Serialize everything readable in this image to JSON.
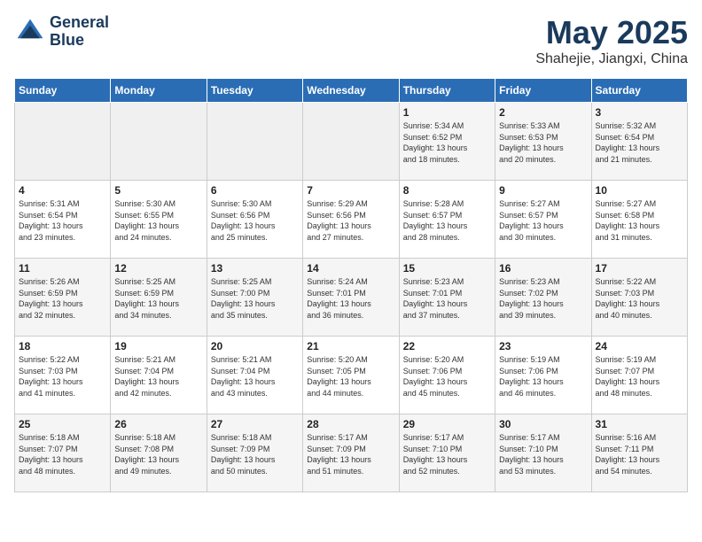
{
  "header": {
    "logo_line1": "General",
    "logo_line2": "Blue",
    "month": "May 2025",
    "location": "Shahejie, Jiangxi, China"
  },
  "weekdays": [
    "Sunday",
    "Monday",
    "Tuesday",
    "Wednesday",
    "Thursday",
    "Friday",
    "Saturday"
  ],
  "weeks": [
    [
      {
        "day": "",
        "info": "",
        "empty": true
      },
      {
        "day": "",
        "info": "",
        "empty": true
      },
      {
        "day": "",
        "info": "",
        "empty": true
      },
      {
        "day": "",
        "info": "",
        "empty": true
      },
      {
        "day": "1",
        "info": "Sunrise: 5:34 AM\nSunset: 6:52 PM\nDaylight: 13 hours\nand 18 minutes.",
        "empty": false
      },
      {
        "day": "2",
        "info": "Sunrise: 5:33 AM\nSunset: 6:53 PM\nDaylight: 13 hours\nand 20 minutes.",
        "empty": false
      },
      {
        "day": "3",
        "info": "Sunrise: 5:32 AM\nSunset: 6:54 PM\nDaylight: 13 hours\nand 21 minutes.",
        "empty": false
      }
    ],
    [
      {
        "day": "4",
        "info": "Sunrise: 5:31 AM\nSunset: 6:54 PM\nDaylight: 13 hours\nand 23 minutes.",
        "empty": false
      },
      {
        "day": "5",
        "info": "Sunrise: 5:30 AM\nSunset: 6:55 PM\nDaylight: 13 hours\nand 24 minutes.",
        "empty": false
      },
      {
        "day": "6",
        "info": "Sunrise: 5:30 AM\nSunset: 6:56 PM\nDaylight: 13 hours\nand 25 minutes.",
        "empty": false
      },
      {
        "day": "7",
        "info": "Sunrise: 5:29 AM\nSunset: 6:56 PM\nDaylight: 13 hours\nand 27 minutes.",
        "empty": false
      },
      {
        "day": "8",
        "info": "Sunrise: 5:28 AM\nSunset: 6:57 PM\nDaylight: 13 hours\nand 28 minutes.",
        "empty": false
      },
      {
        "day": "9",
        "info": "Sunrise: 5:27 AM\nSunset: 6:57 PM\nDaylight: 13 hours\nand 30 minutes.",
        "empty": false
      },
      {
        "day": "10",
        "info": "Sunrise: 5:27 AM\nSunset: 6:58 PM\nDaylight: 13 hours\nand 31 minutes.",
        "empty": false
      }
    ],
    [
      {
        "day": "11",
        "info": "Sunrise: 5:26 AM\nSunset: 6:59 PM\nDaylight: 13 hours\nand 32 minutes.",
        "empty": false
      },
      {
        "day": "12",
        "info": "Sunrise: 5:25 AM\nSunset: 6:59 PM\nDaylight: 13 hours\nand 34 minutes.",
        "empty": false
      },
      {
        "day": "13",
        "info": "Sunrise: 5:25 AM\nSunset: 7:00 PM\nDaylight: 13 hours\nand 35 minutes.",
        "empty": false
      },
      {
        "day": "14",
        "info": "Sunrise: 5:24 AM\nSunset: 7:01 PM\nDaylight: 13 hours\nand 36 minutes.",
        "empty": false
      },
      {
        "day": "15",
        "info": "Sunrise: 5:23 AM\nSunset: 7:01 PM\nDaylight: 13 hours\nand 37 minutes.",
        "empty": false
      },
      {
        "day": "16",
        "info": "Sunrise: 5:23 AM\nSunset: 7:02 PM\nDaylight: 13 hours\nand 39 minutes.",
        "empty": false
      },
      {
        "day": "17",
        "info": "Sunrise: 5:22 AM\nSunset: 7:03 PM\nDaylight: 13 hours\nand 40 minutes.",
        "empty": false
      }
    ],
    [
      {
        "day": "18",
        "info": "Sunrise: 5:22 AM\nSunset: 7:03 PM\nDaylight: 13 hours\nand 41 minutes.",
        "empty": false
      },
      {
        "day": "19",
        "info": "Sunrise: 5:21 AM\nSunset: 7:04 PM\nDaylight: 13 hours\nand 42 minutes.",
        "empty": false
      },
      {
        "day": "20",
        "info": "Sunrise: 5:21 AM\nSunset: 7:04 PM\nDaylight: 13 hours\nand 43 minutes.",
        "empty": false
      },
      {
        "day": "21",
        "info": "Sunrise: 5:20 AM\nSunset: 7:05 PM\nDaylight: 13 hours\nand 44 minutes.",
        "empty": false
      },
      {
        "day": "22",
        "info": "Sunrise: 5:20 AM\nSunset: 7:06 PM\nDaylight: 13 hours\nand 45 minutes.",
        "empty": false
      },
      {
        "day": "23",
        "info": "Sunrise: 5:19 AM\nSunset: 7:06 PM\nDaylight: 13 hours\nand 46 minutes.",
        "empty": false
      },
      {
        "day": "24",
        "info": "Sunrise: 5:19 AM\nSunset: 7:07 PM\nDaylight: 13 hours\nand 48 minutes.",
        "empty": false
      }
    ],
    [
      {
        "day": "25",
        "info": "Sunrise: 5:18 AM\nSunset: 7:07 PM\nDaylight: 13 hours\nand 48 minutes.",
        "empty": false
      },
      {
        "day": "26",
        "info": "Sunrise: 5:18 AM\nSunset: 7:08 PM\nDaylight: 13 hours\nand 49 minutes.",
        "empty": false
      },
      {
        "day": "27",
        "info": "Sunrise: 5:18 AM\nSunset: 7:09 PM\nDaylight: 13 hours\nand 50 minutes.",
        "empty": false
      },
      {
        "day": "28",
        "info": "Sunrise: 5:17 AM\nSunset: 7:09 PM\nDaylight: 13 hours\nand 51 minutes.",
        "empty": false
      },
      {
        "day": "29",
        "info": "Sunrise: 5:17 AM\nSunset: 7:10 PM\nDaylight: 13 hours\nand 52 minutes.",
        "empty": false
      },
      {
        "day": "30",
        "info": "Sunrise: 5:17 AM\nSunset: 7:10 PM\nDaylight: 13 hours\nand 53 minutes.",
        "empty": false
      },
      {
        "day": "31",
        "info": "Sunrise: 5:16 AM\nSunset: 7:11 PM\nDaylight: 13 hours\nand 54 minutes.",
        "empty": false
      }
    ]
  ]
}
